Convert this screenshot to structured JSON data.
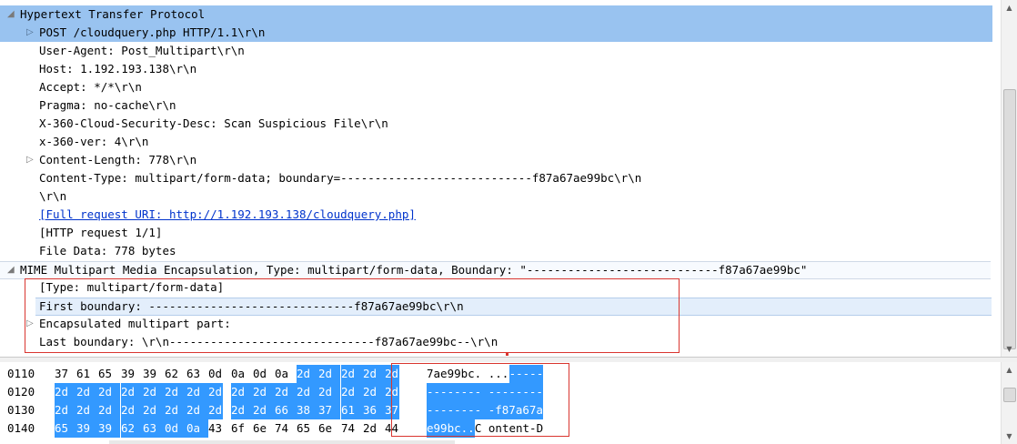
{
  "tree": {
    "http_header": "Hypertext Transfer Protocol",
    "post_line": "POST /cloudquery.php HTTP/1.1\\r\\n",
    "user_agent": "User-Agent: Post_Multipart\\r\\n",
    "host": "Host: 1.192.193.138\\r\\n",
    "accept": "Accept: */*\\r\\n",
    "pragma": "Pragma: no-cache\\r\\n",
    "x360_desc": "X-360-Cloud-Security-Desc: Scan Suspicious File\\r\\n",
    "x360_ver": "x-360-ver: 4\\r\\n",
    "content_length": "Content-Length: 778\\r\\n",
    "content_type": "Content-Type: multipart/form-data; boundary=----------------------------f87a67ae99bc\\r\\n",
    "crlf": "\\r\\n",
    "full_uri": "[Full request URI: http://1.192.193.138/cloudquery.php]",
    "http_request": "[HTTP request 1/1]",
    "file_data": "File Data: 778 bytes",
    "mime_header": "MIME Multipart Media Encapsulation, Type: multipart/form-data, Boundary: \"----------------------------f87a67ae99bc\"",
    "mime_type": "[Type: multipart/form-data]",
    "first_boundary": "First boundary: ------------------------------f87a67ae99bc\\r\\n",
    "encapsulated": "Encapsulated multipart part:",
    "last_boundary": "Last boundary: \\r\\n------------------------------f87a67ae99bc--\\r\\n"
  },
  "hex": {
    "rows": [
      {
        "offset": "0110",
        "bytes": [
          {
            "t": "37",
            "s": false
          },
          {
            "t": "61",
            "s": false
          },
          {
            "t": "65",
            "s": false
          },
          {
            "t": "39",
            "s": false
          },
          {
            "t": "39",
            "s": false
          },
          {
            "t": "62",
            "s": false
          },
          {
            "t": "63",
            "s": false
          },
          {
            "t": "0d",
            "s": false
          },
          {
            "t": "0a",
            "s": false
          },
          {
            "t": "0d",
            "s": false
          },
          {
            "t": "0a",
            "s": false
          },
          {
            "t": "2d",
            "s": true
          },
          {
            "t": "2d",
            "s": true
          },
          {
            "t": "2d",
            "s": true
          },
          {
            "t": "2d",
            "s": true
          },
          {
            "t": "2d",
            "s": true
          }
        ],
        "ascii": [
          {
            "t": "7ae99bc. ...",
            "s": false
          },
          {
            "t": "-----",
            "s": true
          }
        ]
      },
      {
        "offset": "0120",
        "bytes": [
          {
            "t": "2d",
            "s": true
          },
          {
            "t": "2d",
            "s": true
          },
          {
            "t": "2d",
            "s": true
          },
          {
            "t": "2d",
            "s": true
          },
          {
            "t": "2d",
            "s": true
          },
          {
            "t": "2d",
            "s": true
          },
          {
            "t": "2d",
            "s": true
          },
          {
            "t": "2d",
            "s": true
          },
          {
            "t": "2d",
            "s": true
          },
          {
            "t": "2d",
            "s": true
          },
          {
            "t": "2d",
            "s": true
          },
          {
            "t": "2d",
            "s": true
          },
          {
            "t": "2d",
            "s": true
          },
          {
            "t": "2d",
            "s": true
          },
          {
            "t": "2d",
            "s": true
          },
          {
            "t": "2d",
            "s": true
          }
        ],
        "ascii": [
          {
            "t": "-------- --------",
            "s": true
          }
        ]
      },
      {
        "offset": "0130",
        "bytes": [
          {
            "t": "2d",
            "s": true
          },
          {
            "t": "2d",
            "s": true
          },
          {
            "t": "2d",
            "s": true
          },
          {
            "t": "2d",
            "s": true
          },
          {
            "t": "2d",
            "s": true
          },
          {
            "t": "2d",
            "s": true
          },
          {
            "t": "2d",
            "s": true
          },
          {
            "t": "2d",
            "s": true
          },
          {
            "t": "2d",
            "s": true
          },
          {
            "t": "2d",
            "s": true
          },
          {
            "t": "66",
            "s": true
          },
          {
            "t": "38",
            "s": true
          },
          {
            "t": "37",
            "s": true
          },
          {
            "t": "61",
            "s": true
          },
          {
            "t": "36",
            "s": true
          },
          {
            "t": "37",
            "s": true
          }
        ],
        "ascii": [
          {
            "t": "-------- -f87a67a",
            "s": true
          }
        ]
      },
      {
        "offset": "0140",
        "bytes": [
          {
            "t": "65",
            "s": true
          },
          {
            "t": "39",
            "s": true
          },
          {
            "t": "39",
            "s": true
          },
          {
            "t": "62",
            "s": true
          },
          {
            "t": "63",
            "s": true
          },
          {
            "t": "0d",
            "s": true
          },
          {
            "t": "0a",
            "s": true
          },
          {
            "t": "43",
            "s": false
          },
          {
            "t": "6f",
            "s": false
          },
          {
            "t": "6e",
            "s": false
          },
          {
            "t": "74",
            "s": false
          },
          {
            "t": "65",
            "s": false
          },
          {
            "t": "6e",
            "s": false
          },
          {
            "t": "74",
            "s": false
          },
          {
            "t": "2d",
            "s": false
          },
          {
            "t": "44",
            "s": false
          }
        ],
        "ascii": [
          {
            "t": "e99bc..",
            "s": true
          },
          {
            "t": "C ontent-D",
            "s": false
          }
        ]
      }
    ]
  },
  "icons": {
    "expand": "▷",
    "collapse": "◢",
    "scroll_up": "▲",
    "scroll_down": "▼"
  },
  "colors": {
    "selection_main": "#99c3f0",
    "selection_secondary": "#e3eefb",
    "hex_selection": "#3399ff",
    "annotation": "#d9352f",
    "link": "#0033cc"
  }
}
